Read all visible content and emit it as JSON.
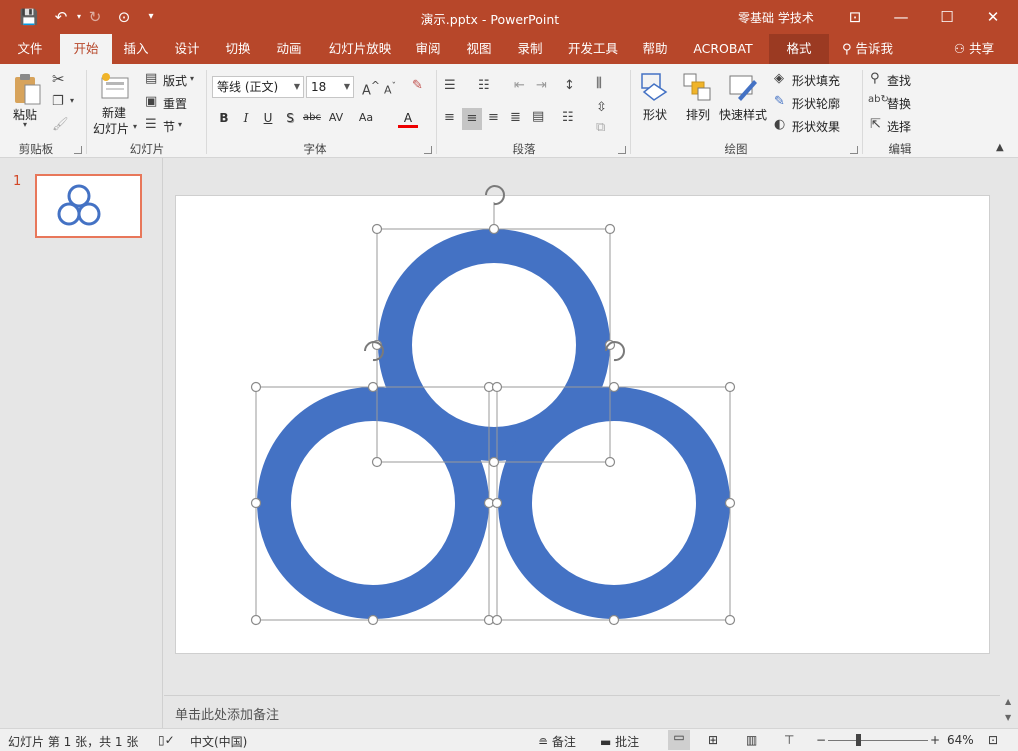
{
  "titlebar": {
    "doc_title": "演示.pptx  -  PowerPoint",
    "account": "零基础 学技术",
    "qat": {
      "save": "💾",
      "undo": "↶",
      "redo": "↻",
      "present": "⊙",
      "customize": "▾"
    },
    "window": {
      "ribbon_display": "⊡",
      "minimize": "—",
      "maximize": "☐",
      "close": "✕"
    }
  },
  "tabs": [
    {
      "label": "文件"
    },
    {
      "label": "开始"
    },
    {
      "label": "插入"
    },
    {
      "label": "设计"
    },
    {
      "label": "切换"
    },
    {
      "label": "动画"
    },
    {
      "label": "幻灯片放映"
    },
    {
      "label": "审阅"
    },
    {
      "label": "视图"
    },
    {
      "label": "录制"
    },
    {
      "label": "开发工具"
    },
    {
      "label": "帮助"
    },
    {
      "label": "ACROBAT"
    },
    {
      "label": "格式"
    }
  ],
  "tell_me": "告诉我",
  "share": "共享",
  "ribbon": {
    "clipboard": {
      "paste": "粘贴",
      "label": "剪贴板"
    },
    "slides": {
      "new_slide_1": "新建",
      "new_slide_2": "幻灯片",
      "layout": "版式",
      "reset": "重置",
      "section": "节",
      "label": "幻灯片"
    },
    "font": {
      "name": "等线 (正文)",
      "size": "18",
      "label": "字体",
      "bold": "B",
      "italic": "I",
      "underline": "U",
      "shadow": "S",
      "strike": "abc",
      "spacing": "AV",
      "case": "Aa",
      "color": "A",
      "grow": "A",
      "shrink": "A"
    },
    "paragraph": {
      "label": "段落"
    },
    "drawing": {
      "shapes": "形状",
      "arrange": "排列",
      "quick_styles": "快速样式",
      "fill": "形状填充",
      "outline": "形状轮廓",
      "effects": "形状效果",
      "label": "绘图"
    },
    "editing": {
      "find": "查找",
      "replace": "替换",
      "select": "选择",
      "label": "编辑"
    }
  },
  "thumbnails": [
    {
      "number": "1"
    }
  ],
  "notes_placeholder": "单击此处添加备注",
  "status": {
    "slide_info": "幻灯片 第 1 张，共 1 张",
    "language": "中文(中国)",
    "notes": "备注",
    "comments": "批注",
    "zoom_minus": "−",
    "zoom_plus": "+",
    "zoom": "64%",
    "zoom_level": 0.64
  },
  "colors": {
    "accent": "#b7472a",
    "ring": "#4472c4",
    "thumb_border": "#e8775a"
  }
}
